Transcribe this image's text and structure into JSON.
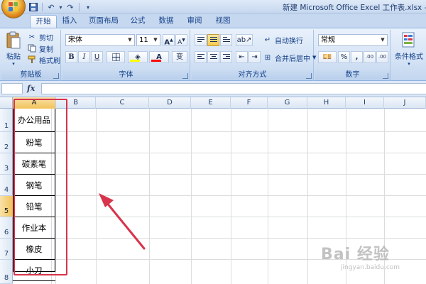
{
  "titlebar": {
    "window_title": "新建 Microsoft Office Excel 工作表.xlsx - Micro",
    "qat_undo_icon": "↶",
    "qat_redo_icon": "↷",
    "qat_dropdown_icon": "▾"
  },
  "tabs": [
    {
      "label": "开始",
      "active": true
    },
    {
      "label": "插入"
    },
    {
      "label": "页面布局"
    },
    {
      "label": "公式"
    },
    {
      "label": "数据"
    },
    {
      "label": "审阅"
    },
    {
      "label": "视图"
    }
  ],
  "ribbon": {
    "clipboard": {
      "group_label": "剪贴板",
      "paste_label": "粘贴",
      "cut_label": "剪切",
      "copy_label": "复制",
      "format_painter_label": "格式刷"
    },
    "font": {
      "group_label": "字体",
      "font_name": "宋体",
      "font_size": "11",
      "grow_label": "A",
      "shrink_label": "A",
      "bold_label": "B",
      "italic_label": "I",
      "underline_label": "U",
      "font_color_label": "A",
      "phonetic_label": "变",
      "fill_color": "#ffff00",
      "font_color": "#ff0000"
    },
    "alignment": {
      "group_label": "对齐方式",
      "wrap_text_label": "自动换行",
      "merge_label": "合并后居中"
    },
    "number": {
      "group_label": "数字",
      "format_value": "常规",
      "percent_label": "%",
      "comma_label": ",",
      "inc_decimal_label": ".00",
      "dec_decimal_label": ".00"
    },
    "styles": {
      "conditional_label": "条件格式"
    }
  },
  "formula_bar": {
    "fx_label": "fx"
  },
  "columns": [
    "A",
    "B",
    "C",
    "D",
    "E",
    "F",
    "G",
    "H",
    "I",
    "J"
  ],
  "rows": [
    "1",
    "2",
    "3",
    "4",
    "5",
    "6",
    "7",
    "8"
  ],
  "active_column": "A",
  "active_row": "5",
  "cells_A": [
    "办公用品",
    "粉笔",
    "碳素笔",
    "钢笔",
    "铅笔",
    "作业本",
    "橡皮",
    "小刀"
  ],
  "annotation_color": "#d8344c",
  "watermark": {
    "main": "Bai 经验",
    "sub": "jingyan.baidu.com"
  }
}
